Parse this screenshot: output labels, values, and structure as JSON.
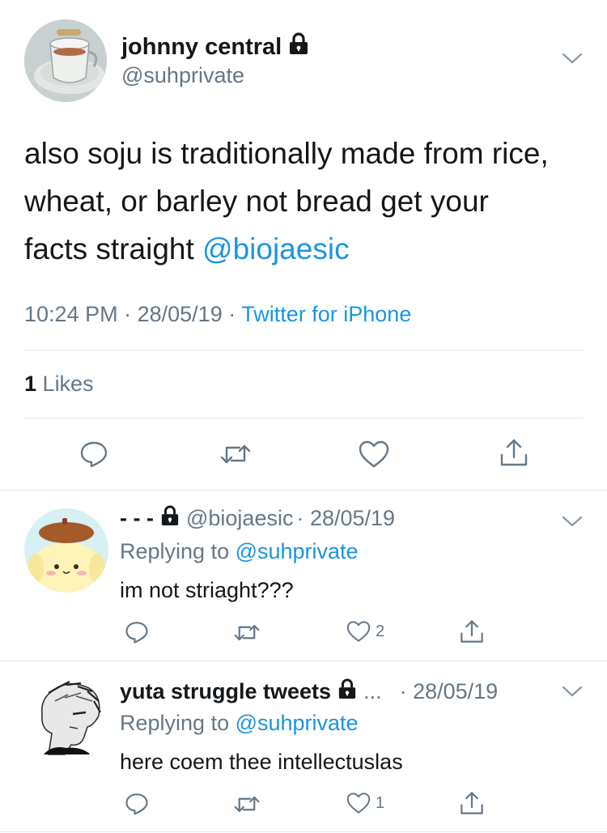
{
  "main": {
    "name": "johnny central",
    "handle": "@suhprivate",
    "text_line1": "also soju is traditionally made from rice,",
    "text_line2": "wheat, or barley not bread get your",
    "text_line3": "facts straight ",
    "mention": "@biojaesic",
    "time": "10:24 PM",
    "date": "28/05/19",
    "source": "Twitter for iPhone",
    "sep": "·",
    "likes_count": "1",
    "likes_label": "Likes"
  },
  "replies": [
    {
      "name": "- - -",
      "handle": "@biojaesic",
      "date": "· 28/05/19",
      "replying_label": "Replying to ",
      "replying_to": "@suhprivate",
      "text": "im not striaght???",
      "like_count": "2"
    },
    {
      "name": "yuta struggle tweets",
      "ellipsis": "...",
      "date": "· 28/05/19",
      "replying_label": "Replying to ",
      "replying_to": "@suhprivate",
      "text": "here coem thee intellectuslas",
      "like_count": "1"
    }
  ],
  "icons": {
    "reply": "reply-icon",
    "retweet": "retweet-icon",
    "like": "heart-icon",
    "share": "share-icon",
    "lock": "lock-icon",
    "menu": "chevron-down-icon"
  },
  "colors": {
    "accent": "#1b95e0",
    "secondary_text": "#657786",
    "divider": "#e1e8ed"
  }
}
